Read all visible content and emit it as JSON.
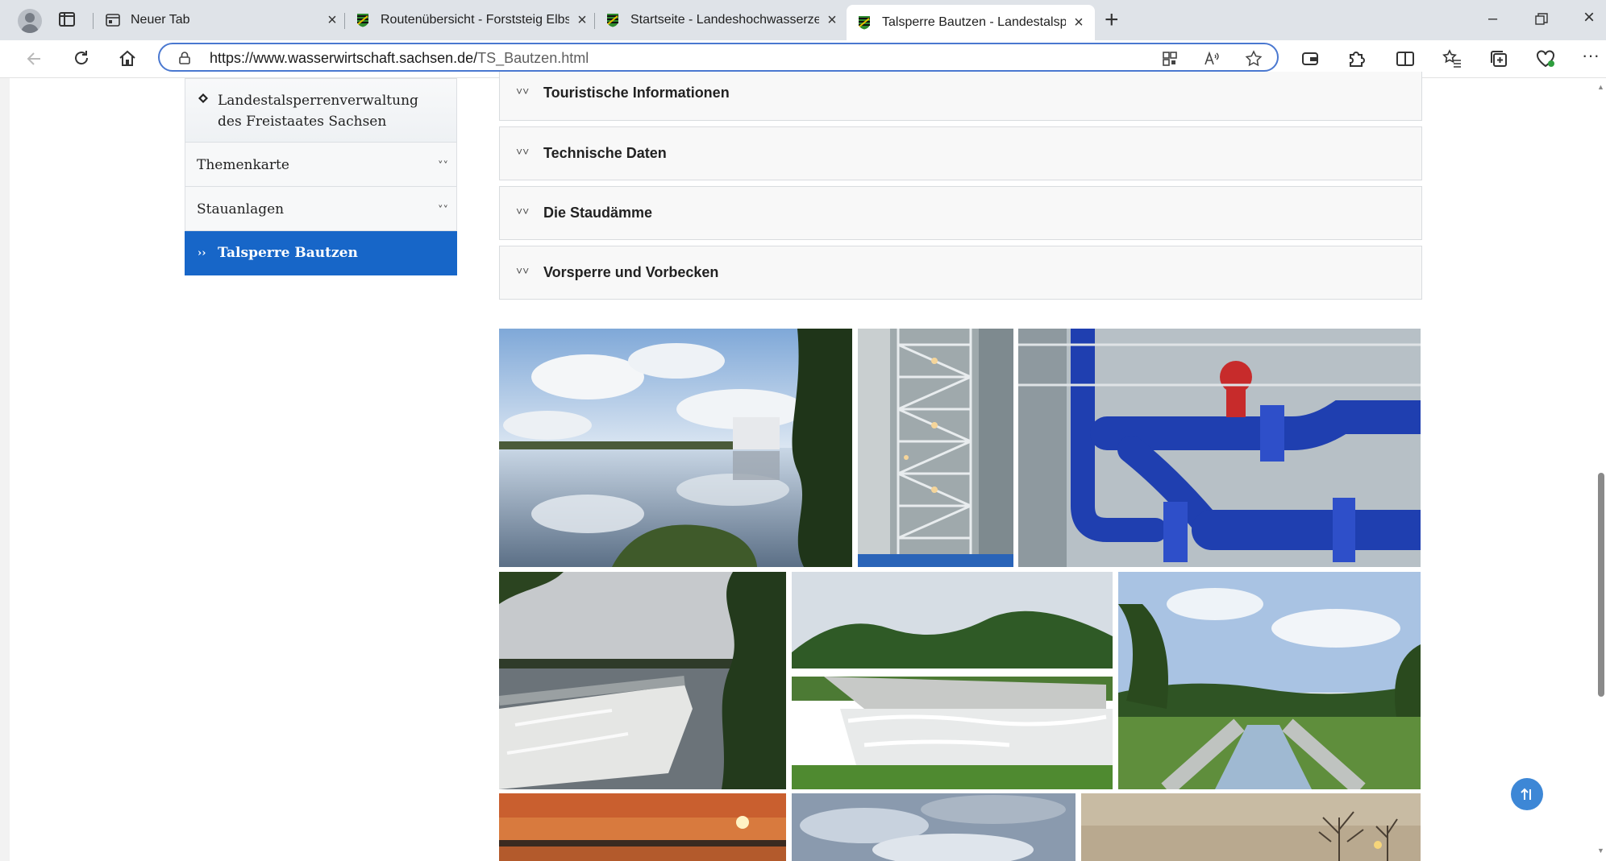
{
  "browser": {
    "tabs": [
      {
        "title": "Neuer Tab",
        "icon": "newtab-icon"
      },
      {
        "title": "Routenübersicht - Forststeig Elbs",
        "icon": "saxony-crest-icon"
      },
      {
        "title": "Startseite - Landeshochwasserzen",
        "icon": "saxony-crest-icon"
      },
      {
        "title": "Talsperre Bautzen - Landestalsper",
        "icon": "saxony-crest-icon",
        "active": true
      }
    ],
    "url_host": "https://www.wasserwirtschaft.sachsen.de/",
    "url_path": "TS_Bautzen.html"
  },
  "sidebar": {
    "items": [
      {
        "label": "Landestalsperrenverwaltung des Freistaates Sachsen"
      },
      {
        "label": "Themenkarte"
      },
      {
        "label": "Stauanlagen"
      },
      {
        "label": "Talsperre Bautzen"
      }
    ]
  },
  "accordion": {
    "items": [
      {
        "label": "Touristische Informationen"
      },
      {
        "label": "Technische Daten"
      },
      {
        "label": "Die Staudämme"
      },
      {
        "label": "Vorsperre und Vorbecken"
      }
    ]
  },
  "colors": {
    "accent": "#1766c8",
    "address_border": "#4a78d0",
    "top_button": "#3d87d6"
  }
}
